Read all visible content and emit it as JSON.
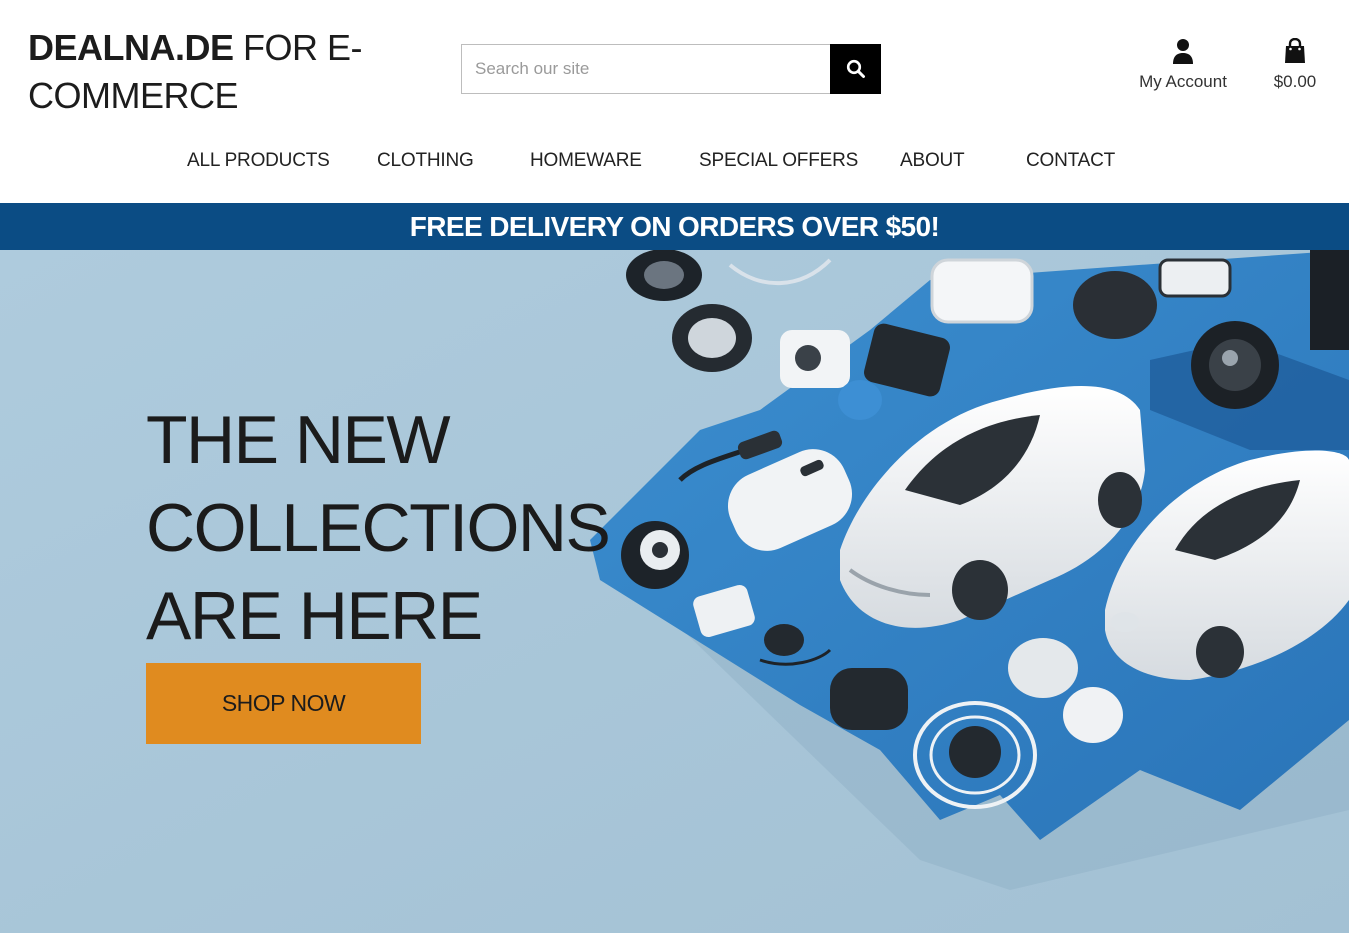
{
  "header": {
    "logo_brand": "DEALNA.DE",
    "logo_rest_line1": "FOR E-",
    "logo_rest_line2": "COMMERCE",
    "search_placeholder": "Search our site",
    "account_label": "My Account",
    "cart_total": "$0.00",
    "icons": {
      "search": "search-icon",
      "account": "user-icon",
      "cart": "shopping-bag-icon"
    }
  },
  "nav": {
    "items": [
      {
        "label": "ALL PRODUCTS"
      },
      {
        "label": "CLOTHING"
      },
      {
        "label": "HOMEWARE"
      },
      {
        "label": "SPECIAL OFFERS"
      },
      {
        "label": "ABOUT"
      },
      {
        "label": "CONTACT"
      }
    ]
  },
  "banner": {
    "text": "FREE DELIVERY ON ORDERS OVER $50!",
    "color": "#0b4c84"
  },
  "hero": {
    "title_lines": [
      "THE NEW",
      "COLLECTIONS",
      "ARE HERE"
    ],
    "cta_label": "SHOP NOW",
    "cta_color": "#e08b1f",
    "background_color": "#a8c6d9"
  }
}
